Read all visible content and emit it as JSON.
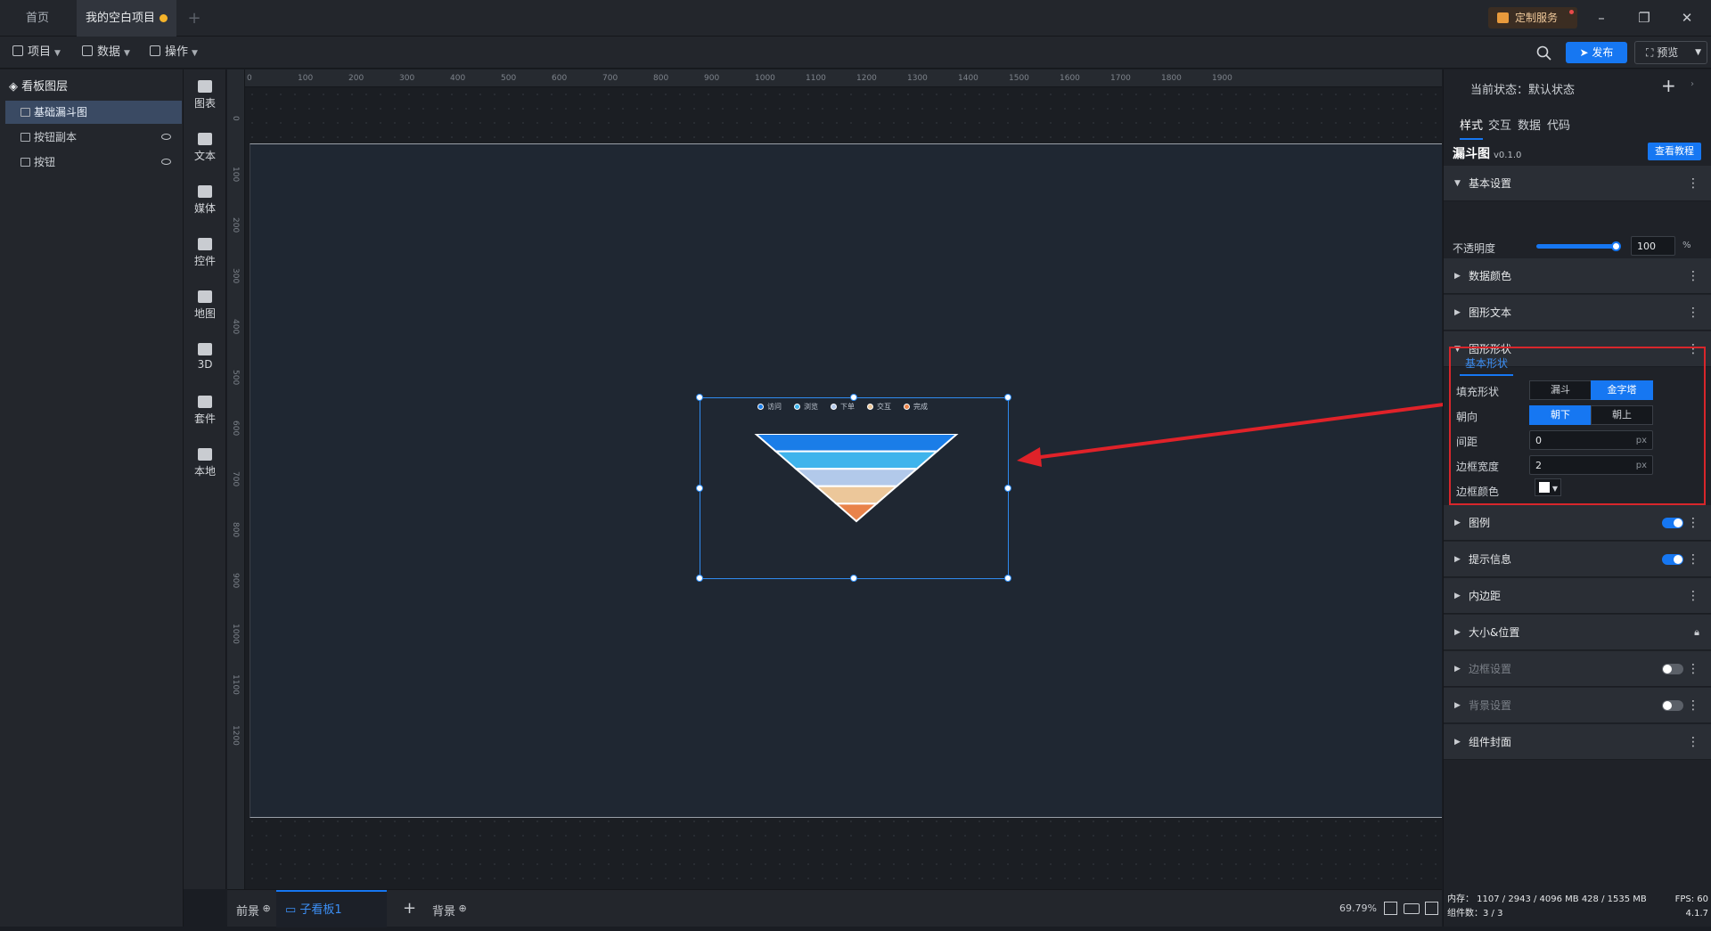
{
  "tabs": {
    "home": "首页",
    "project": "我的空白项目",
    "add": "+"
  },
  "window": {
    "custom_service": "定制服务",
    "minimize": "–",
    "restore": "❐",
    "close": "✕"
  },
  "toolbar": {
    "project": "项目",
    "data": "数据",
    "operate": "操作",
    "publish": "发布",
    "preview": "预览"
  },
  "layers": {
    "title": "看板图层",
    "items": [
      {
        "label": "基础漏斗图"
      },
      {
        "label": "按钮副本"
      },
      {
        "label": "按钮"
      }
    ]
  },
  "rail": {
    "items": [
      {
        "label": "图表"
      },
      {
        "label": "文本"
      },
      {
        "label": "媒体"
      },
      {
        "label": "控件"
      },
      {
        "label": "地图"
      },
      {
        "label": "3D"
      },
      {
        "label": "套件"
      },
      {
        "label": "本地"
      }
    ]
  },
  "ruler": {
    "top": [
      "0",
      "100",
      "200",
      "300",
      "400",
      "500",
      "600",
      "700",
      "800",
      "900",
      "1000",
      "1100",
      "1200",
      "1300",
      "1400",
      "1500",
      "1600",
      "1700",
      "1800",
      "1900"
    ],
    "left": [
      "0",
      "100",
      "200",
      "300",
      "400",
      "500",
      "600",
      "700",
      "800",
      "900",
      "1000",
      "1100",
      "1200"
    ]
  },
  "widget": {
    "legend": [
      {
        "label": "访问",
        "color": "#1a7de8"
      },
      {
        "label": "浏览",
        "color": "#3fb4ec"
      },
      {
        "label": "下单",
        "color": "#b2c9ea"
      },
      {
        "label": "交互",
        "color": "#ecc79a"
      },
      {
        "label": "完成",
        "color": "#e9834a"
      }
    ]
  },
  "chart_data": {
    "type": "funnel",
    "orientation": "down",
    "categories": [
      "访问",
      "浏览",
      "下单",
      "交互",
      "完成"
    ],
    "values": [
      100,
      80,
      60,
      40,
      20
    ],
    "colors": [
      "#1a7de8",
      "#3fb4ec",
      "#b2c9ea",
      "#ecc79a",
      "#e9834a"
    ]
  },
  "bottom": {
    "front": "前景",
    "sub_board": "子看板1",
    "add": "+",
    "background": "背景",
    "zoom": "69.79%"
  },
  "right": {
    "state": "当前状态：默认状态",
    "tabs": [
      "样式",
      "交互",
      "数据",
      "代码"
    ],
    "component": {
      "name": "漏斗图",
      "version": "v0.1.0",
      "tutorial": "查看教程"
    },
    "sections": {
      "basic": "基本设置",
      "data_color": "数据颜色",
      "shape_text": "图形文本",
      "shape_form": "图形形状",
      "legend": "图例",
      "tooltip": "提示信息",
      "padding": "内边距",
      "size_pos": "大小&位置",
      "border": "边框设置",
      "bg": "背景设置",
      "cover": "组件封面"
    },
    "opacity": {
      "label": "不透明度",
      "value": "100",
      "unit": "%",
      "level": 1.0
    },
    "shape": {
      "tab": "基本形状",
      "fill_label": "填充形状",
      "fill_options": [
        "漏斗",
        "金字塔"
      ],
      "fill_selected": "金字塔",
      "dir_label": "朝向",
      "dir_options": [
        "朝下",
        "朝上"
      ],
      "dir_selected": "朝下",
      "gap_label": "间距",
      "gap_value": "0",
      "border_w_label": "边框宽度",
      "border_w_value": "2",
      "unit": "px",
      "border_c_label": "边框颜色",
      "border_color": "#ffffff"
    },
    "status": {
      "memory": "内存： 1107 / 2943 / 4096 MB  428 / 1535 MB",
      "fps": "FPS:  60",
      "count": "组件数：3 / 3",
      "version": "4.1.7"
    }
  }
}
